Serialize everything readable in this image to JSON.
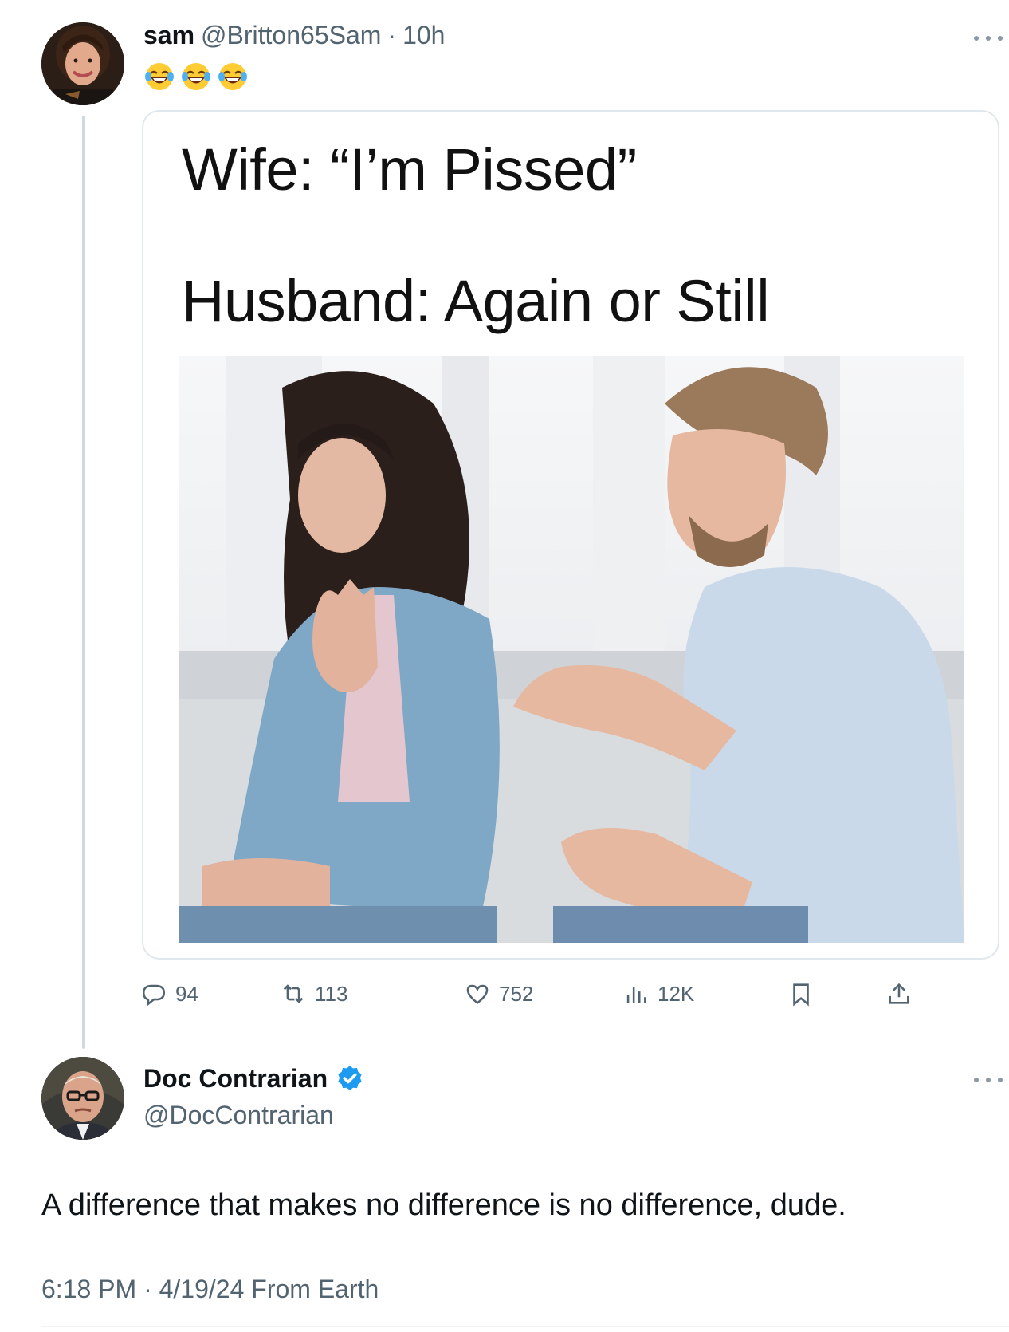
{
  "tweet": {
    "author": {
      "display_name": "sam",
      "handle": "@Britton65Sam",
      "separator": "·",
      "time": "10h"
    },
    "emoji_text": [
      "laughing-tears-emoji",
      "laughing-tears-emoji",
      "laughing-tears-emoji"
    ],
    "media": {
      "line1": "Wife: “I’m Pissed”",
      "line2": "Husband: Again or Still"
    },
    "actions": {
      "replies": "94",
      "retweets": "113",
      "likes": "752",
      "views": "12K"
    }
  },
  "reply": {
    "author": {
      "display_name": "Doc Contrarian",
      "handle": "@DocContrarian",
      "verified": true
    },
    "text": "A difference that makes no difference is no difference, dude.",
    "meta": "6:18 PM · 4/19/24 From Earth"
  },
  "colors": {
    "text_primary": "#0f1419",
    "text_secondary": "#536471",
    "verified_blue": "#1d9bf0",
    "border": "#e1e8ed"
  }
}
